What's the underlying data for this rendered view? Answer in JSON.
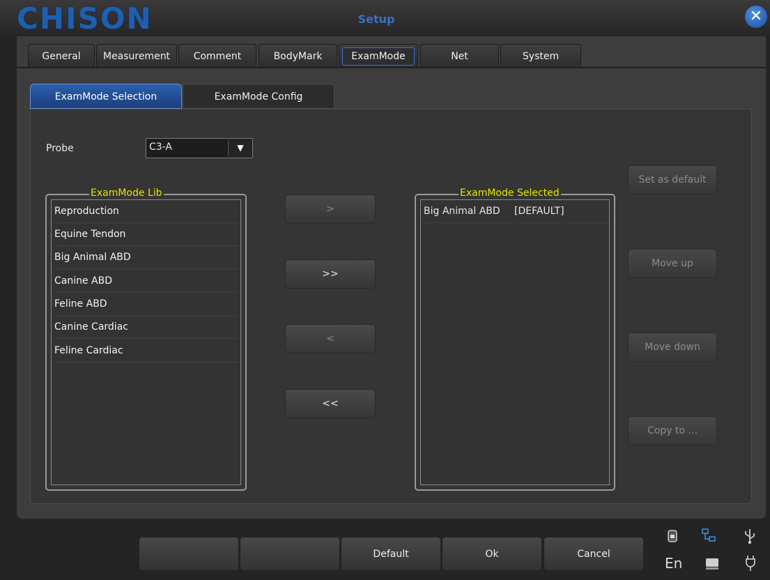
{
  "window": {
    "brand": "CHISON",
    "title": "Setup"
  },
  "tabs": [
    {
      "label": "General"
    },
    {
      "label": "Measurement"
    },
    {
      "label": "Comment"
    },
    {
      "label": "BodyMark"
    },
    {
      "label": "ExamMode",
      "active": true
    },
    {
      "label": "Net"
    },
    {
      "label": "System"
    }
  ],
  "subtabs": [
    {
      "label": "ExamMode Selection",
      "active": true
    },
    {
      "label": "ExamMode Config"
    }
  ],
  "probe": {
    "label": "Probe",
    "value": "C3-A"
  },
  "lib": {
    "title": "ExamMode Lib",
    "items": [
      "Reproduction",
      "Equine Tendon",
      "Big Animal ABD",
      "Canine ABD",
      "Feline ABD",
      "Canine Cardiac",
      "Feline Cardiac"
    ]
  },
  "transfer": {
    "add": ">",
    "add_all": ">>",
    "remove": "<",
    "remove_all": "<<"
  },
  "selected": {
    "title": "ExamMode Selected",
    "items": [
      {
        "name": "Big Animal ABD",
        "tag": "[DEFAULT]"
      }
    ]
  },
  "actions": {
    "set_default": "Set as default",
    "move_up": "Move up",
    "move_down": "Move down",
    "copy_to": "Copy to ..."
  },
  "footer": {
    "blank1": "",
    "blank2": "",
    "default": "Default",
    "ok": "Ok",
    "cancel": "Cancel"
  },
  "tray": {
    "language": "En"
  },
  "colors": {
    "accent": "#2b5fae",
    "legend": "#e6e600",
    "brand": "#1f5fb0"
  }
}
